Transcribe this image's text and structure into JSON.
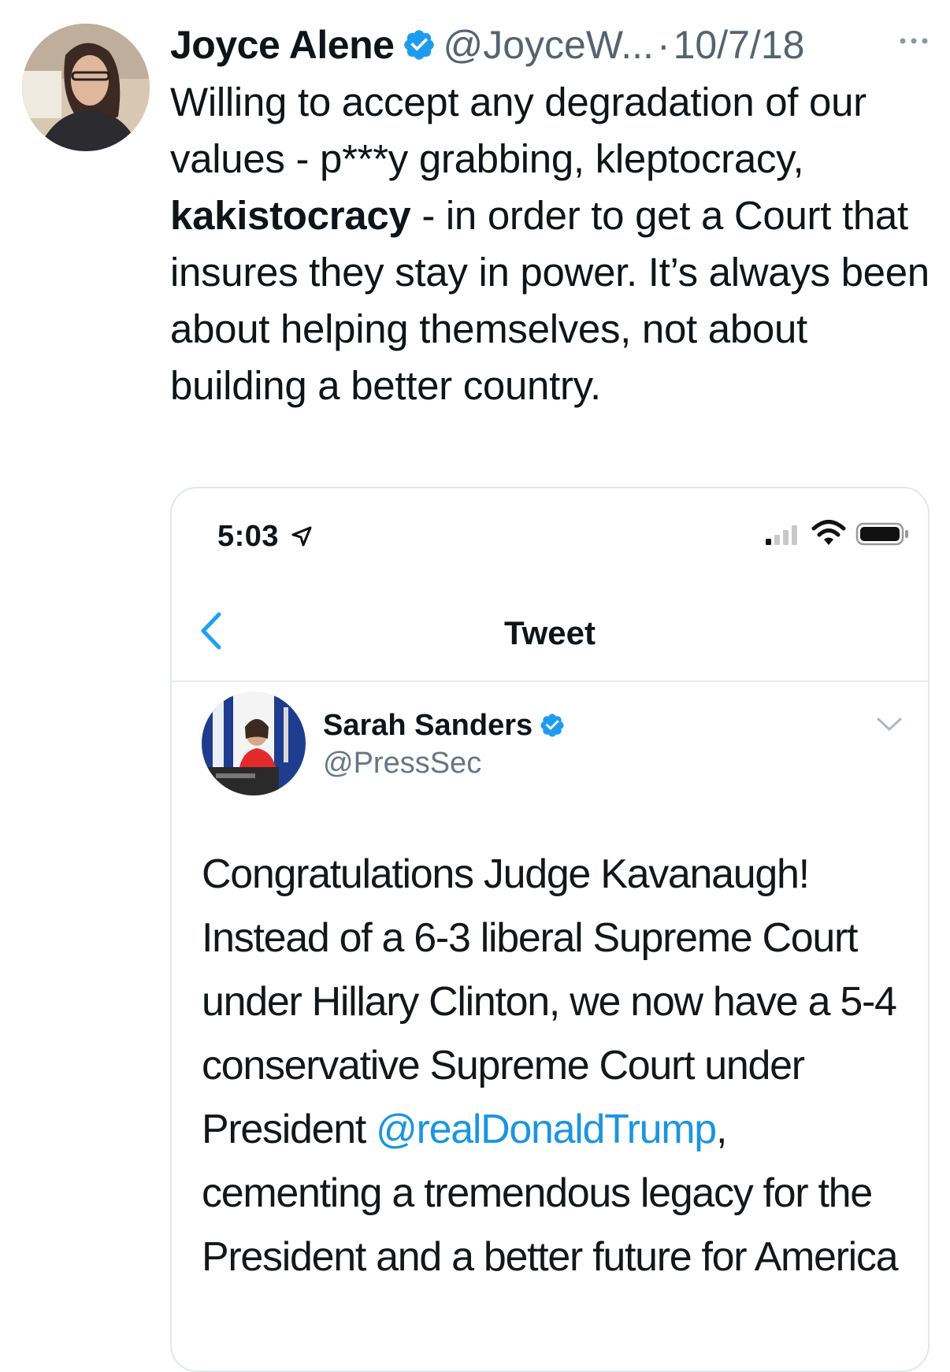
{
  "tweet": {
    "author_name": "Joyce Alene",
    "handle": "@JoyceW...",
    "separator": "·",
    "date": "10/7/18",
    "text_1": "Willing to accept any degradation of our values - p***y grabbing, kleptocracy, ",
    "text_bold": "kakistocracy",
    "text_2": " - in order to get a Court that insures they stay in power. It’s always been about helping themselves, not about building a better country.",
    "avatar_icon": "profile-photo",
    "verified_icon": "verified-badge-icon",
    "more_icon": "more-dots-icon"
  },
  "screenshot": {
    "status_bar": {
      "time": "5:03",
      "icons": [
        "location-arrow-icon",
        "signal-icon",
        "wifi-icon",
        "battery-icon"
      ]
    },
    "nav": {
      "title": "Tweet",
      "back_icon": "back-chevron-icon"
    },
    "quoted": {
      "author_name": "Sarah Sanders",
      "handle": "@PressSec",
      "text_1": "Congratulations Judge Kavanaugh! Instead of a 6-3 liberal Supreme Court under Hillary Clinton, we now have a 5-4 conservative Supreme Court under President ",
      "mention": "@realDonaldTrump",
      "text_2": ", cementing a tremendous legacy for the President and a better future for America",
      "dropdown_icon": "chevron-down-icon"
    }
  },
  "colors": {
    "verified": "#1d9bf0",
    "handle_gray": "#536471",
    "link": "#1b95e0",
    "border": "#e1e8ed"
  }
}
